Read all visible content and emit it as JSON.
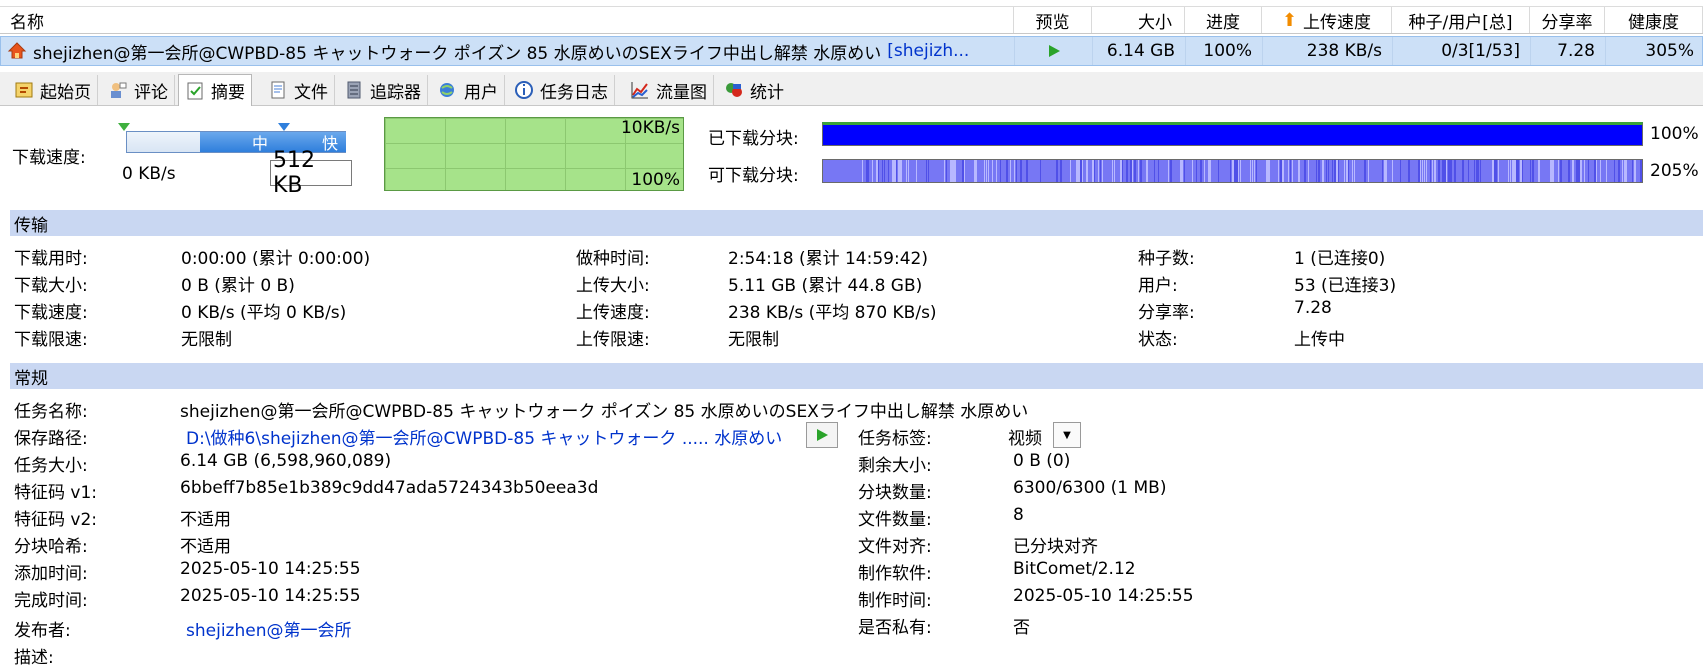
{
  "list": {
    "columns": {
      "name": "名称",
      "preview": "预览",
      "size": "大小",
      "progress": "进度",
      "upload_speed": "上传速度",
      "seeds_users": "种子/用户[总]",
      "ratio": "分享率",
      "health": "健康度"
    },
    "row": {
      "name": "shejizhen@第一会所@CWPBD-85 キャットウォーク ポイズン 85 水原めいのSEXライフ中出し解禁  水原めい",
      "name_suffix": "[shejizh...",
      "size": "6.14 GB",
      "progress": "100%",
      "upload_speed": "238 KB/s",
      "seeds_users": "0/3[1/53]",
      "ratio": "7.28",
      "health": "305%"
    }
  },
  "tabs": [
    {
      "label": "起始页"
    },
    {
      "label": "评论"
    },
    {
      "label": "摘要"
    },
    {
      "label": "文件"
    },
    {
      "label": "追踪器"
    },
    {
      "label": "用户"
    },
    {
      "label": "任务日志"
    },
    {
      "label": "流量图"
    },
    {
      "label": "统计"
    }
  ],
  "speed": {
    "label": "下载速度:",
    "current": "0 KB/s",
    "slider_mid": "中",
    "slider_fast": "快",
    "limit": "512 KB",
    "graph_top": "10KB/s",
    "graph_bottom": "100%"
  },
  "pieces": {
    "downloaded_label": "已下载分块:",
    "downloaded_value": "100%",
    "available_label": "可下载分块:",
    "available_value": "205%"
  },
  "transfer": {
    "title": "传输",
    "col1": [
      {
        "k": "下载用时:",
        "v": "0:00:00 (累计 0:00:00)"
      },
      {
        "k": "下载大小:",
        "v": "0 B (累计 0 B)"
      },
      {
        "k": "下载速度:",
        "v": "0 KB/s (平均 0 KB/s)"
      },
      {
        "k": "下载限速:",
        "v": "无限制"
      }
    ],
    "col2": [
      {
        "k": "做种时间:",
        "v": "2:54:18 (累计 14:59:42)"
      },
      {
        "k": "上传大小:",
        "v": "5.11 GB (累计 44.8 GB)"
      },
      {
        "k": "上传速度:",
        "v": "238 KB/s (平均 870 KB/s)"
      },
      {
        "k": "上传限速:",
        "v": "无限制"
      }
    ],
    "col3": [
      {
        "k": "种子数:",
        "v": "1 (已连接0)"
      },
      {
        "k": "用户:",
        "v": "53 (已连接3)"
      },
      {
        "k": "分享率:",
        "v": "7.28"
      },
      {
        "k": "状态:",
        "v": "上传中"
      }
    ]
  },
  "general": {
    "title": "常规",
    "task_name_label": "任务名称:",
    "task_name": "shejizhen@第一会所@CWPBD-85 キャットウォーク ポイズン 85 水原めいのSEXライフ中出し解禁  水原めい",
    "save_path_label": "保存路径:",
    "save_path": "D:\\做种6\\shejizhen@第一会所@CWPBD-85 キャットウォーク ..... 水原めい",
    "tag_label": "任务标签:",
    "tag_value": "视频",
    "left": [
      {
        "k": "任务大小:",
        "v": "6.14 GB (6,598,960,089)"
      },
      {
        "k": "特征码 v1:",
        "v": "6bbeff7b85e1b389c9dd47ada5724343b50eea3d"
      },
      {
        "k": "特征码 v2:",
        "v": "不适用"
      },
      {
        "k": "分块哈希:",
        "v": "不适用"
      },
      {
        "k": "添加时间:",
        "v": "2025-05-10 14:25:55"
      },
      {
        "k": "完成时间:",
        "v": "2025-05-10 14:25:55"
      }
    ],
    "right": [
      {
        "k": "剩余大小:",
        "v": "0 B (0)"
      },
      {
        "k": "分块数量:",
        "v": "6300/6300 (1 MB)"
      },
      {
        "k": "文件数量:",
        "v": "8"
      },
      {
        "k": "文件对齐:",
        "v": "已分块对齐"
      },
      {
        "k": "制作软件:",
        "v": "BitComet/2.12"
      },
      {
        "k": "制作时间:",
        "v": "2025-05-10 14:25:55"
      },
      {
        "k": "是否私有:",
        "v": "否"
      }
    ],
    "publisher_label": "发布者:",
    "publisher": "shejizhen@第一会所",
    "description_label": "描述:"
  },
  "colors": {
    "accent_blue": "#0000ff",
    "section_bg": "#c9d7f2",
    "graph_green": "#a6e38a"
  }
}
